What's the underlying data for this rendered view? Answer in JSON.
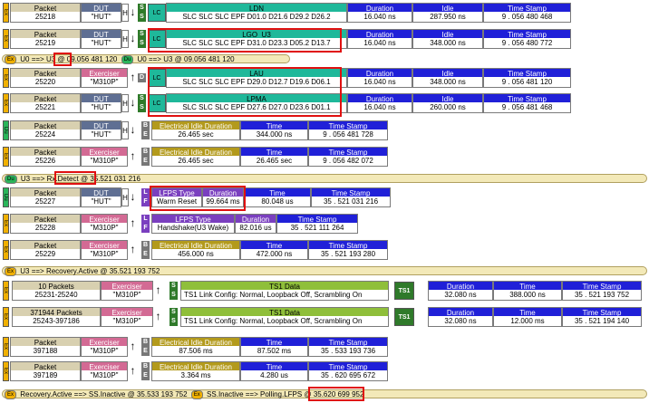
{
  "headers": {
    "packet": "Packet",
    "dut": "DUT",
    "exerciser": "Exerciser",
    "duration": "Duration",
    "idle": "Idle",
    "time_stamp": "Time Stamp",
    "time": "Time",
    "eid": "Electrical Idle Duration",
    "lfps_type": "LFPS Type",
    "ts1_data": "TS1 Data",
    "ts1": "TS1"
  },
  "letters": {
    "h": "H",
    "s": "S",
    "b": "B",
    "e": "E",
    "l": "L",
    "f": "F",
    "d": "D",
    "lc": "LC",
    "ex": "Ex",
    "du": "Du"
  },
  "rows": [
    {
      "packet": "25218",
      "src": "\"HUT\"",
      "lc_title": "LDN",
      "lc_data": "SLC SLC SLC EPF D01.0 D21.6 D29.2 D26.2",
      "duration": "16.040 ns",
      "idle": "287.950 ns",
      "time_stamp": "9 . 056 480 468"
    },
    {
      "packet": "25219",
      "src": "\"HUT\"",
      "lc_title": "LGO_U3",
      "lc_data": "SLC SLC SLC EPF D31.0 D23.3 D05.2 D13.7",
      "duration": "16.040 ns",
      "idle": "348.000 ns",
      "time_stamp": "9 . 056 480 772"
    },
    {
      "packet": "25220",
      "src": "\"M310P\"",
      "lc_title": "LAU",
      "lc_data": "SLC SLC SLC EPF D29.0 D12.7 D19.6 D06.1",
      "duration": "16.040 ns",
      "idle": "348.000 ns",
      "time_stamp": "9 . 056 481 120"
    },
    {
      "packet": "25221",
      "src": "\"HUT\"",
      "lc_title": "LPMA",
      "lc_data": "SLC SLC SLC EPF D27.6 D27.0 D23.6 D01.1",
      "duration": "16.040 ns",
      "idle": "260.000 ns",
      "time_stamp": "9 . 056 481 468"
    },
    {
      "packet": "25224",
      "src": "\"HUT\"",
      "eid": "26.465 sec",
      "time": "344.000 ns",
      "time_stamp": "9 . 056 481 728"
    },
    {
      "packet": "25226",
      "src": "\"M310P\"",
      "eid": "26.465 sec",
      "time": "26.465 sec",
      "time_stamp": "9 . 056 482 072"
    },
    {
      "packet": "25227",
      "src": "\"HUT\"",
      "lfps_type": "Warm Reset",
      "duration": "99.664 ms",
      "time": "80.048 us",
      "time_stamp": "35 . 521 031 216"
    },
    {
      "packet": "25228",
      "src": "\"M310P\"",
      "lfps_type": "Handshake(U3 Wake)",
      "duration": "82.016 us",
      "time_stamp": "35 . 521 111 264"
    },
    {
      "packet": "25229",
      "src": "\"M310P\"",
      "eid": "456.000 ns",
      "time": "472.000 ns",
      "time_stamp": "35 . 521 193 280"
    },
    {
      "packet": "25231-25240",
      "count": "10 Packets",
      "src": "\"M310P\"",
      "ts1_data": "TS1 Link Config: Normal, Loopback Off, Scrambling On",
      "duration": "32.080 ns",
      "time": "388.000 ns",
      "time_stamp": "35 . 521 193 752"
    },
    {
      "packet": "25243-397186",
      "count": "371944 Packets",
      "src": "\"M310P\"",
      "ts1_data": "TS1 Link Config: Normal, Loopback Off, Scrambling On",
      "duration": "32.080 ns",
      "time": "12.000 ms",
      "time_stamp": "35 . 521 194 140"
    },
    {
      "packet": "397188",
      "src": "\"M310P\"",
      "eid": "87.506 ms",
      "time": "87.502 ms",
      "time_stamp": "35 . 533 193 736"
    },
    {
      "packet": "397189",
      "src": "\"M310P\"",
      "eid": "3.364 ms",
      "time": "4.280 us",
      "time_stamp": "35 . 620 695 672"
    }
  ],
  "states": [
    {
      "prefix": "U0 ==>",
      "state": "U3",
      "suffix": "@ 09.056 481 120",
      "tail": "U0 ==> U3 @ 09.056 481 120"
    },
    {
      "prefix": "U3 ==>",
      "state": "Rx.Detect",
      "suffix": "@ 35.521 031 216"
    },
    {
      "prefix": "U3 ==> Recovery.Active @ 35.521 193 752"
    },
    {
      "prefix": "Recovery.Active ==> SS.Inactive @ 35.533 193 752",
      "second_prefix": "SS.Inactive ==>",
      "state": "Polling.LFPS",
      "suffix": "@ 35.620 699 952"
    }
  ],
  "colors": {
    "highlight": "#e01010",
    "ex_pill": "#f0b000",
    "du_pill": "#2ab55a"
  }
}
